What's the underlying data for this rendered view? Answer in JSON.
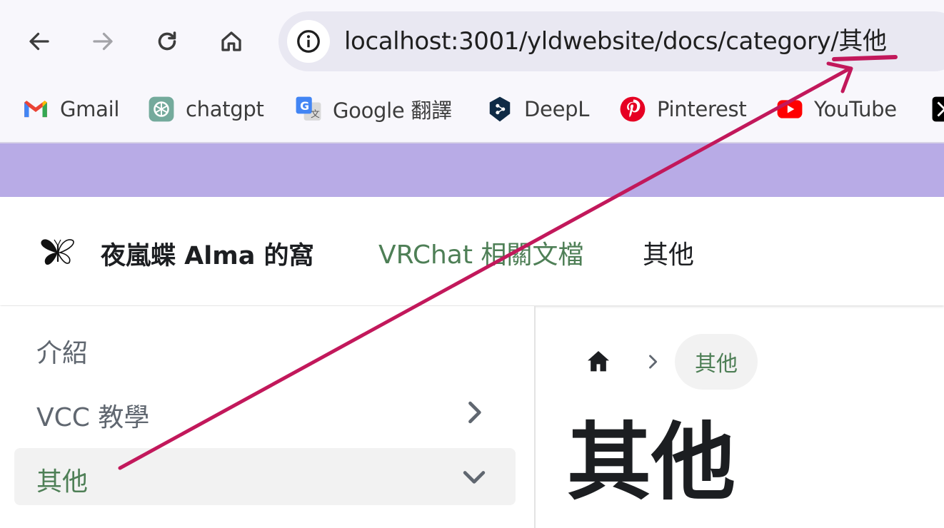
{
  "browser": {
    "url": "localhost:3001/yldwebsite/docs/category/其他",
    "nav_icons": [
      "back-arrow-icon",
      "forward-arrow-icon",
      "reload-icon",
      "home-icon"
    ],
    "bookmarks": [
      {
        "label": "Gmail",
        "icon": "gmail-icon"
      },
      {
        "label": "chatgpt",
        "icon": "chatgpt-icon"
      },
      {
        "label": "Google 翻譯",
        "icon": "google-translate-icon"
      },
      {
        "label": "DeepL",
        "icon": "deepl-icon"
      },
      {
        "label": "Pinterest",
        "icon": "pinterest-icon"
      },
      {
        "label": "YouTube",
        "icon": "youtube-icon"
      }
    ]
  },
  "navbar": {
    "brand": "夜嵐蝶 Alma 的窩",
    "logo_icon": "butterfly-icon",
    "links": [
      "VRChat 相關文檔",
      "其他"
    ]
  },
  "sidebar": {
    "items": [
      {
        "label": "介紹"
      },
      {
        "label": "VCC 教學",
        "icon": "chevron-right-icon"
      },
      {
        "label": "其他",
        "icon": "chevron-down-icon",
        "active": true
      }
    ]
  },
  "breadcrumb": {
    "home_icon": "home-icon",
    "current": "其他"
  },
  "page": {
    "title": "其他"
  },
  "colors": {
    "announcement_bar": "#b8abe6",
    "link_green": "#4e7f56",
    "annotation_arrow": "#c2185b"
  }
}
